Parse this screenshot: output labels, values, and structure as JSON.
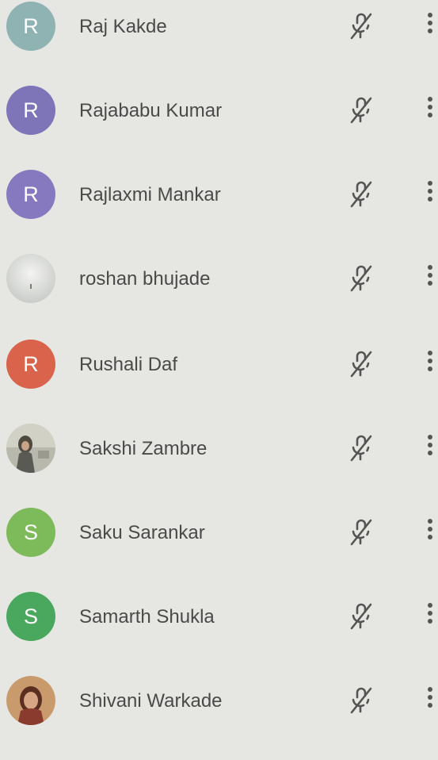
{
  "participants": [
    {
      "name": "Raj Kakde",
      "initial": "R",
      "avatar_color": "#8fb3b3",
      "avatar_type": "initial",
      "mic_icon": "mic-off-icon",
      "menu_icon": "more-vert-icon"
    },
    {
      "name": "Rajababu Kumar",
      "initial": "R",
      "avatar_color": "#7e75b8",
      "avatar_type": "initial",
      "mic_icon": "mic-off-icon",
      "menu_icon": "more-vert-icon"
    },
    {
      "name": "Rajlaxmi Mankar",
      "initial": "R",
      "avatar_color": "#8679bf",
      "avatar_type": "initial",
      "mic_icon": "mic-off-icon",
      "menu_icon": "more-vert-icon"
    },
    {
      "name": "roshan bhujade",
      "initial": "",
      "avatar_color": "#dcdcd8",
      "avatar_type": "photo",
      "mic_icon": "mic-off-icon",
      "menu_icon": "more-vert-icon"
    },
    {
      "name": "Rushali Daf",
      "initial": "R",
      "avatar_color": "#d9634b",
      "avatar_type": "initial",
      "mic_icon": "mic-off-icon",
      "menu_icon": "more-vert-icon"
    },
    {
      "name": "Sakshi Zambre",
      "initial": "",
      "avatar_color": "#9a9a8f",
      "avatar_type": "photo",
      "mic_icon": "mic-off-icon",
      "menu_icon": "more-vert-icon"
    },
    {
      "name": "Saku Sarankar",
      "initial": "S",
      "avatar_color": "#7dba5a",
      "avatar_type": "initial",
      "mic_icon": "mic-off-icon",
      "menu_icon": "more-vert-icon"
    },
    {
      "name": "Samarth Shukla",
      "initial": "S",
      "avatar_color": "#4aa85e",
      "avatar_type": "initial",
      "mic_icon": "mic-off-icon",
      "menu_icon": "more-vert-icon"
    },
    {
      "name": "Shivani Warkade",
      "initial": "",
      "avatar_color": "#b07a4e",
      "avatar_type": "photo",
      "mic_icon": "mic-off-icon",
      "menu_icon": "more-vert-icon"
    }
  ]
}
